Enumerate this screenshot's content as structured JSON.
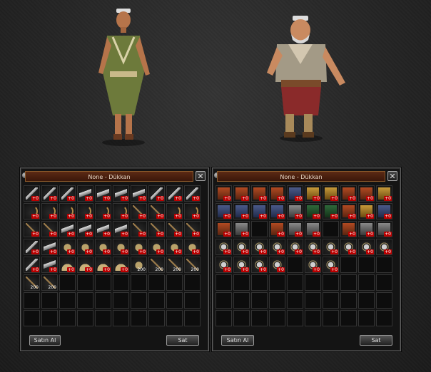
{
  "shop_left": {
    "title": "None - Dükkan",
    "buy_label": "Satın Al",
    "sell_label": "Sat",
    "close_glyph": "✕",
    "rows": [
      [
        "sword",
        "sword",
        "sword",
        "blade",
        "blade",
        "blade",
        "blade",
        "sword",
        "sword",
        "sword"
      ],
      [
        "bow",
        "bow",
        "bow",
        "bow",
        "bow",
        "bow",
        "spear",
        "spear",
        "bow",
        "bow"
      ],
      [
        "spear",
        "spear",
        "blade",
        "blade",
        "blade",
        "blade",
        "spear",
        "spear",
        "spear",
        "spear"
      ],
      [
        "sword",
        "blade",
        "bell",
        "bell",
        "bell",
        "bell",
        "bell",
        "bell",
        "bell",
        "bell"
      ],
      [
        "sword",
        "blade",
        "fan",
        "fan",
        "fan",
        "fan",
        "bell",
        "spear",
        "spear",
        "spear"
      ],
      [
        "spear",
        "spear",
        "",
        "",
        "",
        "",
        "",
        "",
        "",
        ""
      ],
      [
        "",
        "",
        "",
        "",
        "",
        "",
        "",
        "",
        "",
        ""
      ],
      [
        "",
        "",
        "",
        "",
        "",
        "",
        "",
        "",
        "",
        ""
      ]
    ],
    "counts": {
      "4-6": "200",
      "4-7": "200",
      "4-8": "200",
      "4-9": "200",
      "5-0": "200",
      "5-1": "200"
    },
    "badge_text": "+0"
  },
  "shop_right": {
    "title": "None - Dükkan",
    "buy_label": "Satın Al",
    "sell_label": "Sat",
    "close_glyph": "✕",
    "rows": [
      [
        "red",
        "red",
        "red",
        "red",
        "blue",
        "gold",
        "gold",
        "red",
        "red",
        "gold"
      ],
      [
        "blue",
        "blue",
        "blue",
        "blue",
        "grey",
        "green",
        "green",
        "red",
        "gold",
        "blue"
      ],
      [
        "red",
        "grey",
        "",
        "red",
        "grey",
        "grey",
        "",
        "red",
        "grey",
        "grey"
      ],
      [
        "acc",
        "acc",
        "acc",
        "acc",
        "acc",
        "acc",
        "acc",
        "acc",
        "acc",
        "acc"
      ],
      [
        "acc",
        "acc",
        "acc",
        "acc",
        "",
        "acc",
        "acc",
        "",
        "",
        ""
      ],
      [
        "",
        "",
        "",
        "",
        "",
        "",
        "",
        "",
        "",
        ""
      ],
      [
        "",
        "",
        "",
        "",
        "",
        "",
        "",
        "",
        "",
        ""
      ],
      [
        "",
        "",
        "",
        "",
        "",
        "",
        "",
        "",
        "",
        ""
      ]
    ],
    "badge_text": "+0"
  },
  "colors": {
    "titlebar": "#5b2a14",
    "title_border": "#8b5a2b",
    "panel": "#141414",
    "background": "#2b2b2b"
  }
}
